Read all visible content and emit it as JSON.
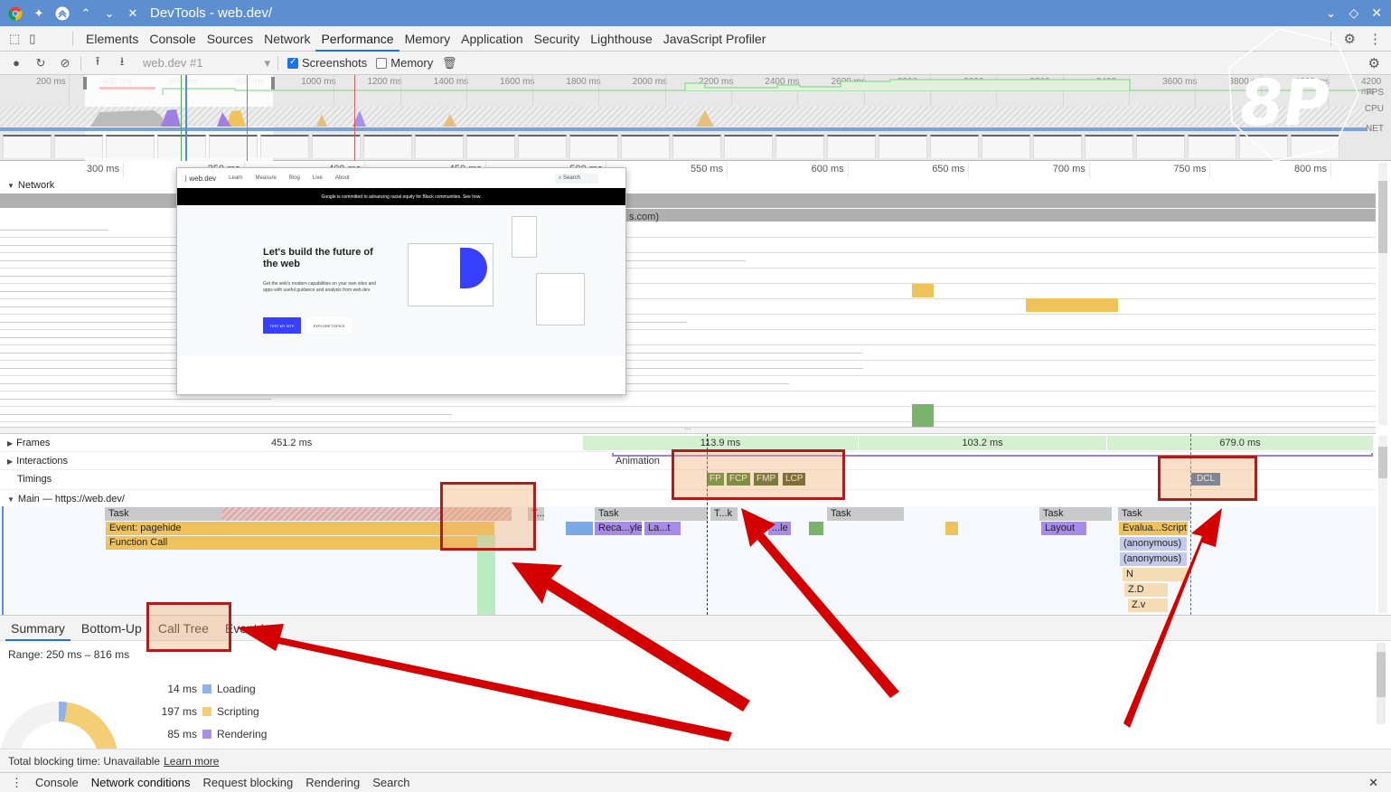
{
  "window": {
    "title": "DevTools - web.dev/"
  },
  "panel_tabs": [
    "Elements",
    "Console",
    "Sources",
    "Network",
    "Performance",
    "Memory",
    "Application",
    "Security",
    "Lighthouse",
    "JavaScript Profiler"
  ],
  "active_panel": "Performance",
  "toolbar": {
    "profile_select": "web.dev #1",
    "screenshots_label": "Screenshots",
    "screenshots_checked": true,
    "memory_label": "Memory",
    "memory_checked": false
  },
  "overview": {
    "ticks": [
      "200 ms",
      "400 ms",
      "600 ms",
      "800 ms",
      "1000 ms",
      "1200 ms",
      "1400 ms",
      "1600 ms",
      "1800 ms",
      "2000 ms",
      "2200 ms",
      "2400 ms",
      "2600 ms",
      "2800 ms",
      "3000 ms",
      "3200 ms",
      "3400 ms",
      "3600 ms",
      "3800 ms",
      "4000 ms",
      "4200 ms"
    ],
    "labels": {
      "fps": "FPS",
      "cpu": "CPU",
      "net": "NET"
    }
  },
  "ruler_ticks": [
    "300 ms",
    "350 ms",
    "400 ms",
    "450 ms",
    "500 ms",
    "550 ms",
    "600 ms",
    "650 ms",
    "700 ms",
    "750 ms",
    "800 ms"
  ],
  "network": {
    "label": "Network",
    "request_suffix": "s.com)"
  },
  "screenshot_popup": {
    "brand": "web.dev",
    "nav": [
      "Learn",
      "Measure",
      "Blog",
      "Live",
      "About"
    ],
    "search": "Search",
    "banner": "Google is committed to advancing racial equity for Black communities. See how.",
    "headline": "Let's build the future of the web",
    "body": "Get the web's modern capabilities on your own sites and apps with useful guidance and analysis from web.dev.",
    "primary_button": "TEST MY SITE",
    "secondary_button": "EXPLORE TOPICS"
  },
  "tracks": {
    "frames": {
      "label": "Frames",
      "values": [
        "451.2 ms",
        "113.9 ms",
        "103.2 ms",
        "679.0 ms"
      ]
    },
    "interactions": {
      "label": "Interactions",
      "animation": "Animation"
    },
    "timings": {
      "label": "Timings",
      "markers": [
        "FP",
        "FCP",
        "FMP",
        "LCP",
        "DCL"
      ]
    },
    "main": {
      "label": "Main — https://web.dev/",
      "tasks": [
        "Task",
        "T...",
        "Task",
        "T...k",
        "Task",
        "Task",
        "Task"
      ],
      "events": [
        "Event: pagehide",
        "Function Call",
        "Reca...yle",
        "La...t",
        "...le",
        "Layout",
        "Evalua...Script",
        "(anonymous)",
        "(anonymous)",
        "N",
        "Z.D",
        "Z.v"
      ]
    }
  },
  "bottom": {
    "tabs": [
      "Summary",
      "Bottom-Up",
      "Call Tree",
      "Event Log"
    ],
    "active_tab": "Summary",
    "range": "Range: 250 ms – 816 ms",
    "summary": [
      {
        "value": "14 ms",
        "label": "Loading",
        "color": "#8fb3e8"
      },
      {
        "value": "197 ms",
        "label": "Scripting",
        "color": "#f4cd74"
      },
      {
        "value": "85 ms",
        "label": "Rendering",
        "color": "#ab90e8"
      }
    ],
    "tbt": "Total blocking time: Unavailable",
    "learn_more": "Learn more"
  },
  "drawer": {
    "tabs": [
      "Console",
      "Network conditions",
      "Request blocking",
      "Rendering",
      "Search"
    ]
  },
  "watermark": "8P"
}
